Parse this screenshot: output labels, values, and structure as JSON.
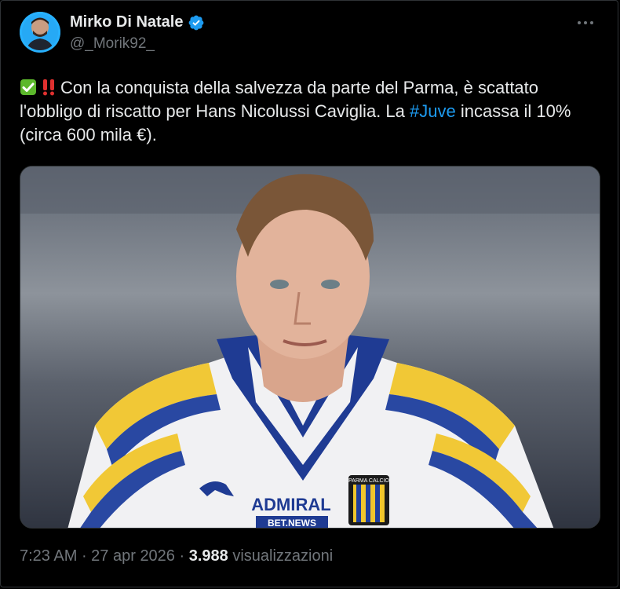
{
  "author": {
    "display_name": "Mirko Di Natale",
    "handle": "@_Morik92_",
    "verified_icon": "verified-badge-icon",
    "avatar_icon": "avatar-photo"
  },
  "tweet": {
    "emojis": [
      "check-mark-icon",
      "double-exclamation-icon"
    ],
    "text_part1": "Con la conquista della salvezza da parte del Parma, è scattato l'obbligo di riscatto per Hans Nicolussi Caviglia. La ",
    "hashtag": "#Juve",
    "text_part2": " incassa il 10% (circa 600 mila €)."
  },
  "media": {
    "sponsor": "ADMIRAL",
    "sponsor_sub": "BET.NEWS",
    "crest_text": "PARMA CALCIO"
  },
  "meta": {
    "time": "7:23 AM",
    "separator": " · ",
    "date": "27 apr 2026",
    "views_count": "3.988",
    "views_label": " visualizzazioni"
  },
  "colors": {
    "background": "#000000",
    "text": "#e7e9ea",
    "muted": "#71767b",
    "link": "#1d9bf0",
    "verified": "#1d9bf0"
  }
}
